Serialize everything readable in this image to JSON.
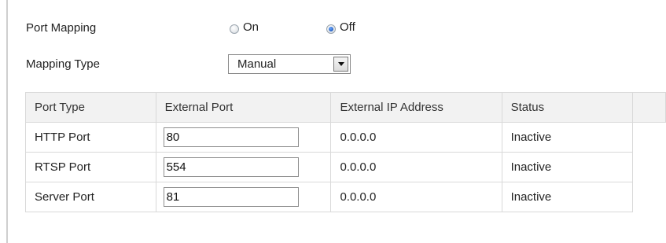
{
  "port_mapping": {
    "label": "Port Mapping",
    "options": [
      {
        "label": "On",
        "checked": false
      },
      {
        "label": "Off",
        "checked": true
      }
    ]
  },
  "mapping_type": {
    "label": "Mapping Type",
    "selected": "Manual"
  },
  "table": {
    "headers": [
      "Port Type",
      "External Port",
      "External IP Address",
      "Status"
    ],
    "rows": [
      {
        "port_type": "HTTP Port",
        "external_port": "80",
        "external_ip": "0.0.0.0",
        "status": "Inactive"
      },
      {
        "port_type": "RTSP Port",
        "external_port": "554",
        "external_ip": "0.0.0.0",
        "status": "Inactive"
      },
      {
        "port_type": "Server Port",
        "external_port": "81",
        "external_ip": "0.0.0.0",
        "status": "Inactive"
      }
    ]
  }
}
